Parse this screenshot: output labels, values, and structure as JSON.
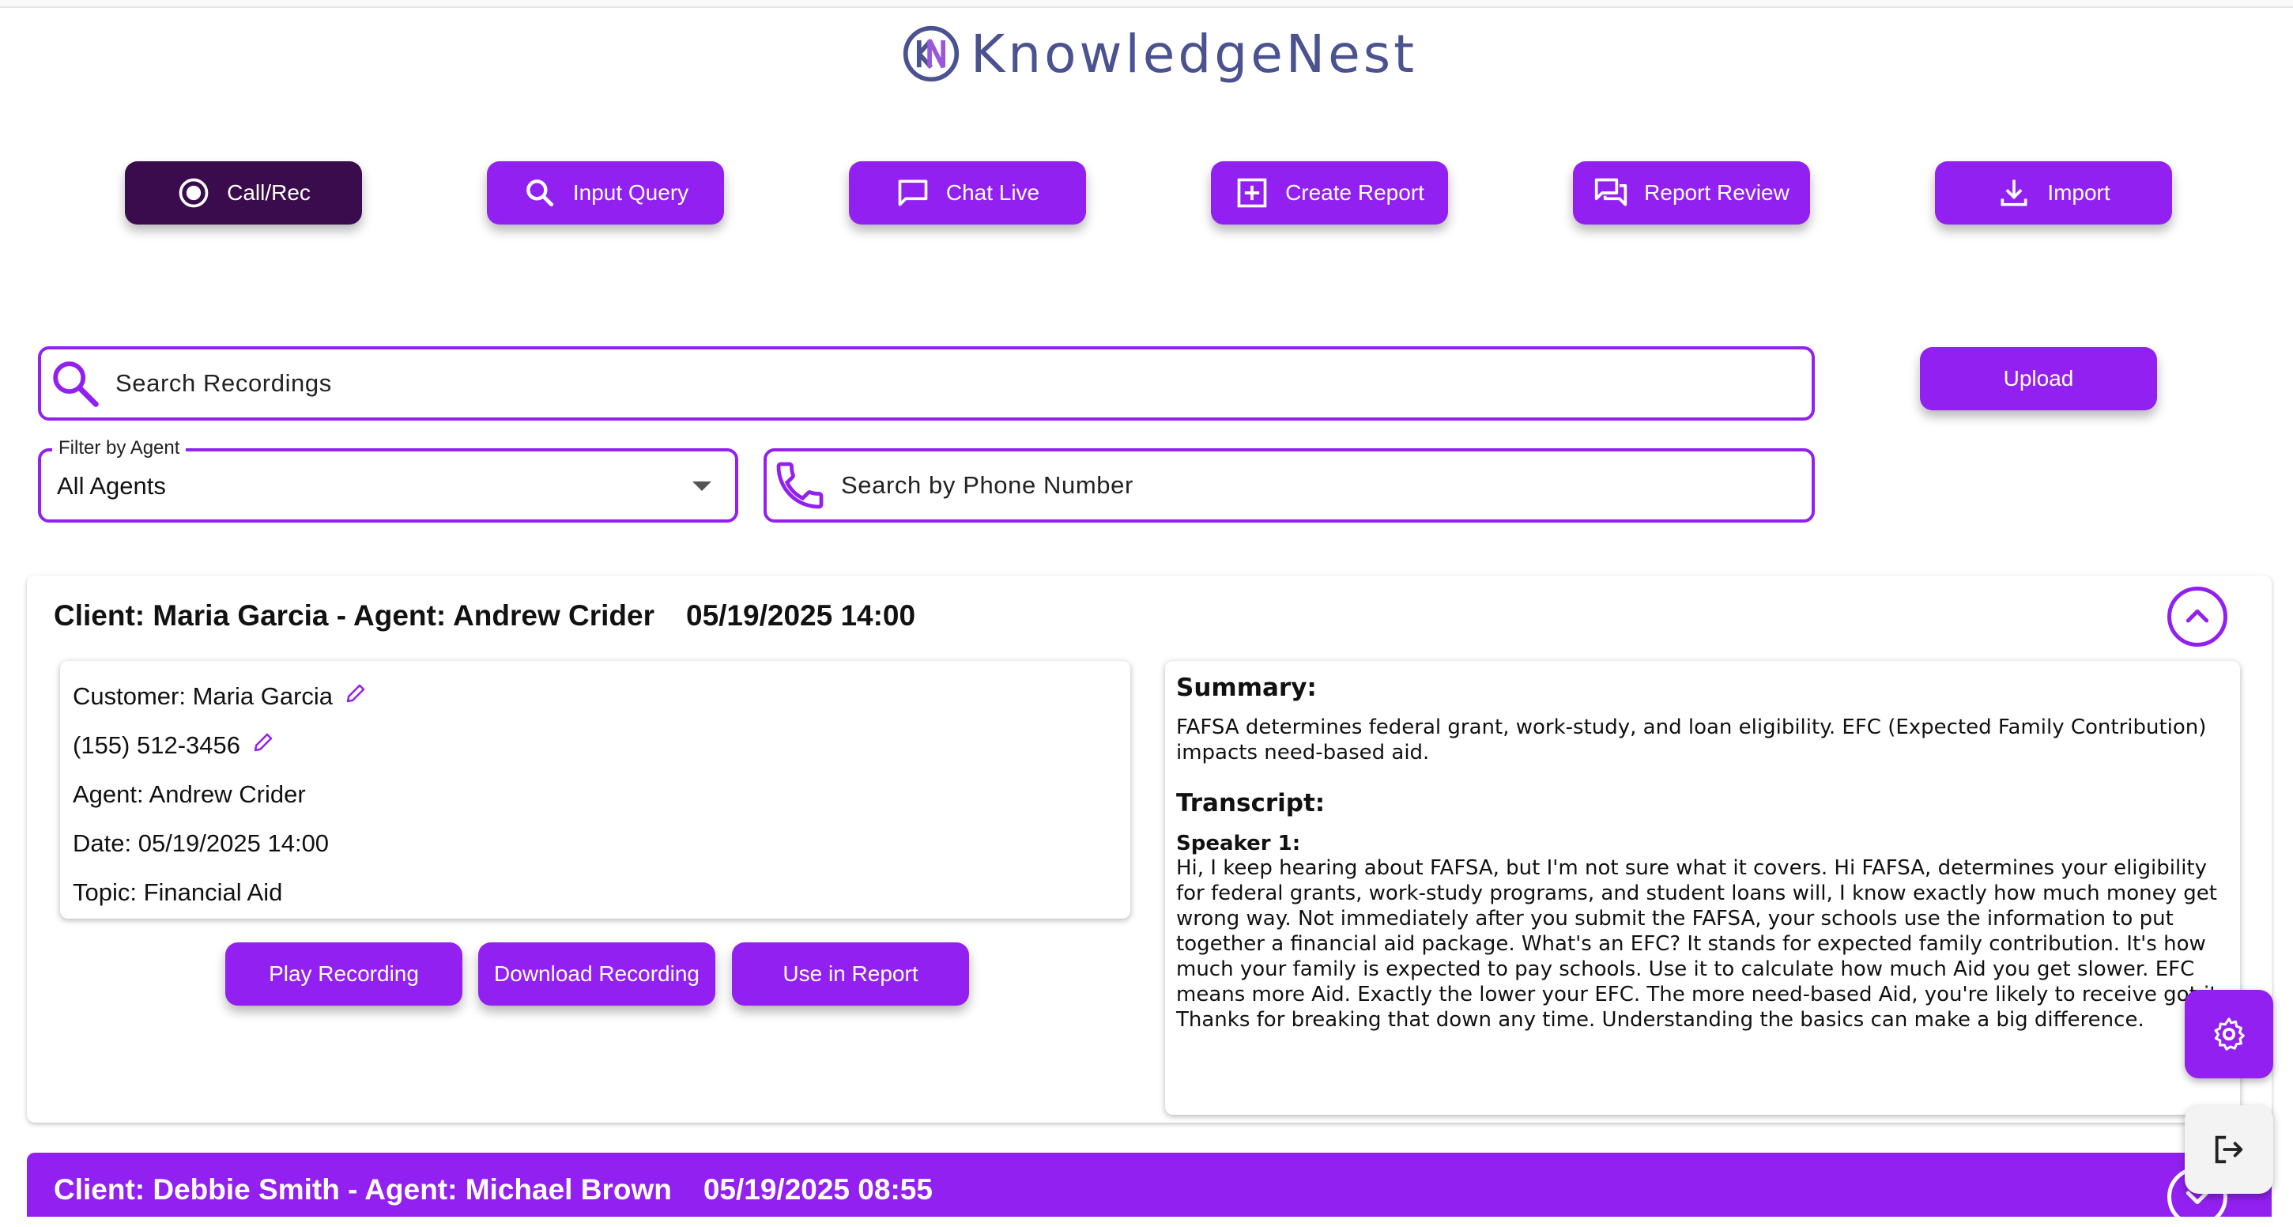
{
  "app": {
    "name": "KnowledgeNest"
  },
  "nav": {
    "items": [
      {
        "label": "Call/Rec",
        "icon": "record-icon",
        "active": true
      },
      {
        "label": "Input Query",
        "icon": "search-icon"
      },
      {
        "label": "Chat Live",
        "icon": "chat-icon"
      },
      {
        "label": "Create Report",
        "icon": "add-box-icon"
      },
      {
        "label": "Report Review",
        "icon": "forum-icon"
      },
      {
        "label": "Import",
        "icon": "download-icon"
      }
    ]
  },
  "search": {
    "placeholder": "Search Recordings"
  },
  "upload_label": "Upload",
  "filter": {
    "legend": "Filter by Agent",
    "value": "All Agents"
  },
  "phone_search": {
    "placeholder": "Search by Phone Number"
  },
  "recordings": [
    {
      "header_client": "Client: Maria Garcia - Agent: Andrew Crider",
      "header_datetime": "05/19/2025 14:00",
      "customer": "Customer: Maria Garcia",
      "phone": "(155) 512-3456",
      "agent": "Agent: Andrew Crider",
      "date": "Date: 05/19/2025 14:00",
      "topic": "Topic: Financial Aid",
      "buttons": {
        "play": "Play Recording",
        "download": "Download Recording",
        "use": "Use in Report"
      },
      "summary_title": "Summary:",
      "summary": "FAFSA determines federal grant, work-study, and loan eligibility. EFC (Expected Family Contribution) impacts need-based aid.",
      "transcript_title": "Transcript:",
      "speaker": "Speaker 1:",
      "transcript": "Hi, I keep hearing about FAFSA, but I'm not sure what it covers. Hi FAFSA, determines your eligibility for federal grants, work-study programs, and student loans will, I know exactly how much money get wrong way. Not immediately after you submit the FAFSA, your schools use the information to put together a financial aid package. What's an EFC? It stands for expected family contribution. It's how much your family is expected to pay schools. Use it to calculate how much Aid you get slower. EFC means more Aid. Exactly the lower your EFC. The more need-based Aid, you're likely to receive got it. Thanks for breaking that down any time. Understanding the basics can make a big difference."
    },
    {
      "header_client": "Client: Debbie Smith - Agent: Michael Brown",
      "header_datetime": "05/19/2025 08:55"
    }
  ],
  "colors": {
    "accent": "#9220f0",
    "active_nav": "#3a0c4e",
    "logo": "#4a5290"
  }
}
